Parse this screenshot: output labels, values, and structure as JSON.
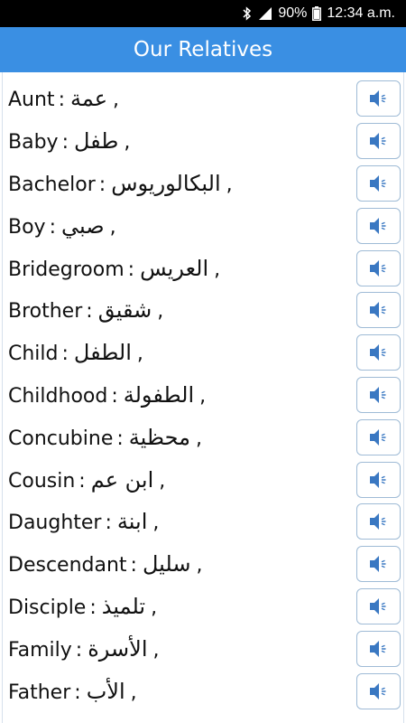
{
  "status_bar": {
    "battery_percent": "90%",
    "time": "12:34 a.m.",
    "icons": [
      "bluetooth-icon",
      "signal-icon",
      "battery-icon"
    ]
  },
  "app_bar": {
    "title": "Our Relatives"
  },
  "colors": {
    "app_bar": "#3a8fe3",
    "status_bar": "#000000",
    "speaker_icon": "#3a78c2"
  },
  "words": [
    {
      "en": "Aunt",
      "ar": "عمة"
    },
    {
      "en": "Baby",
      "ar": "طفل"
    },
    {
      "en": "Bachelor",
      "ar": "البكالوريوس"
    },
    {
      "en": "Boy",
      "ar": "صبي"
    },
    {
      "en": "Bridegroom",
      "ar": "العريس"
    },
    {
      "en": "Brother",
      "ar": "شقيق"
    },
    {
      "en": "Child",
      "ar": "الطفل"
    },
    {
      "en": "Childhood",
      "ar": "الطفولة"
    },
    {
      "en": "Concubine",
      "ar": "محظية"
    },
    {
      "en": "Cousin",
      "ar": "ابن عم"
    },
    {
      "en": "Daughter",
      "ar": "ابنة"
    },
    {
      "en": "Descendant",
      "ar": "سليل"
    },
    {
      "en": "Disciple",
      "ar": "تلميذ"
    },
    {
      "en": "Family",
      "ar": "الأسرة"
    },
    {
      "en": "Father",
      "ar": "الأب"
    }
  ],
  "separator": ":",
  "trailing": ","
}
